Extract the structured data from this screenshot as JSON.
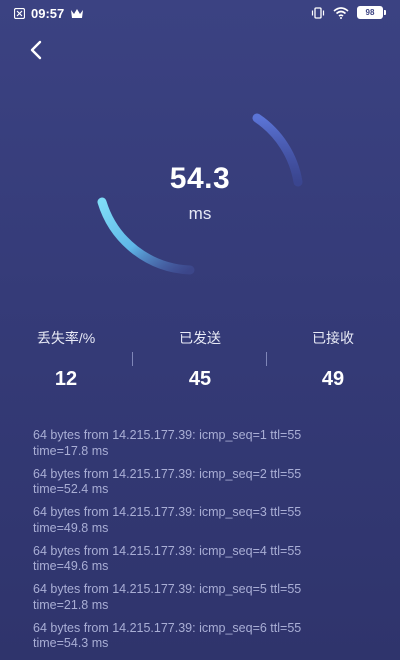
{
  "status_bar": {
    "time": "09:57",
    "battery": "98"
  },
  "gauge": {
    "value": "54.3",
    "unit": "ms"
  },
  "stats": [
    {
      "label": "丢失率/%",
      "value": "12"
    },
    {
      "label": "已发送",
      "value": "45"
    },
    {
      "label": "已接收",
      "value": "49"
    }
  ],
  "log": [
    {
      "line1": "64 bytes from 14.215.177.39: icmp_seq=1 ttl=55",
      "line2": "time=17.8 ms"
    },
    {
      "line1": "64 bytes from 14.215.177.39: icmp_seq=2 ttl=55",
      "line2": "time=52.4 ms"
    },
    {
      "line1": "64 bytes from 14.215.177.39: icmp_seq=3 ttl=55",
      "line2": "time=49.8 ms"
    },
    {
      "line1": "64 bytes from 14.215.177.39: icmp_seq=4 ttl=55",
      "line2": "time=49.6 ms"
    },
    {
      "line1": "64 bytes from 14.215.177.39: icmp_seq=5 ttl=55",
      "line2": "time=21.8 ms"
    },
    {
      "line1": "64 bytes from 14.215.177.39: icmp_seq=6 ttl=55",
      "line2": "time=54.3 ms"
    }
  ],
  "colors": {
    "background": "#373d7b",
    "arc_start": "#6fd1f0",
    "arc_end": "#5b74d6",
    "log_text": "#a9aed5"
  },
  "icons": [
    "notification-icon",
    "crown-icon",
    "vibrate-icon",
    "wifi-icon",
    "battery-icon",
    "back-arrow-icon"
  ]
}
